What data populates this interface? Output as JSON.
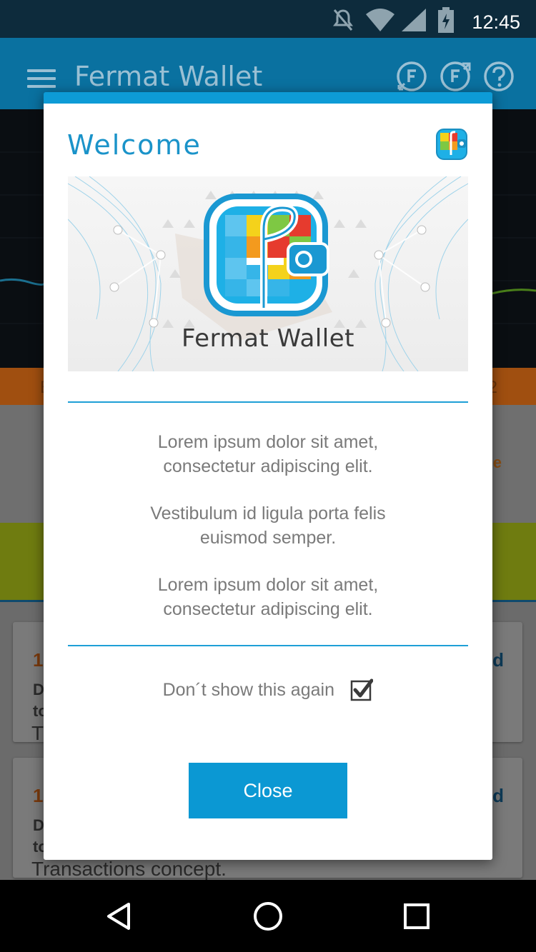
{
  "status_bar": {
    "time": "12:45",
    "icons": [
      "mute-icon",
      "wifi-icon",
      "signal-icon",
      "battery-icon"
    ]
  },
  "toolbar": {
    "title": "Fermat Wallet",
    "actions": [
      "send-receive-icon",
      "fermat-exchange-icon",
      "help-icon"
    ]
  },
  "background": {
    "orange_left": "B",
    "orange_right": "2",
    "peek_text": "e",
    "cards": [
      {
        "num": "1",
        "line1": "D",
        "line2": "to",
        "line3": "T",
        "right": "d"
      },
      {
        "num": "1",
        "line1": "D",
        "line2": "to",
        "line3": "Transactions concept.",
        "right": "d"
      }
    ]
  },
  "dialog": {
    "title": "Welcome",
    "brand": "Fermat Wallet",
    "paragraphs": [
      [
        "Lorem ipsum dolor sit amet,",
        "consectetur adipiscing elit."
      ],
      [
        "Vestibulum id ligula porta felis",
        "euismod semper."
      ],
      [
        "Lorem ipsum dolor sit amet,",
        "consectetur adipiscing elit."
      ]
    ],
    "checkbox_label": "Don´t show this again",
    "checkbox_checked": true,
    "close_label": "Close"
  },
  "nav_bar": {
    "buttons": [
      "back-icon",
      "home-icon",
      "recents-icon"
    ]
  },
  "colors": {
    "accent": "#0d9bd6",
    "toolbar": "#0a71a0",
    "dialog_bg": "#ffffff",
    "text_gray": "#7a7a7a"
  }
}
